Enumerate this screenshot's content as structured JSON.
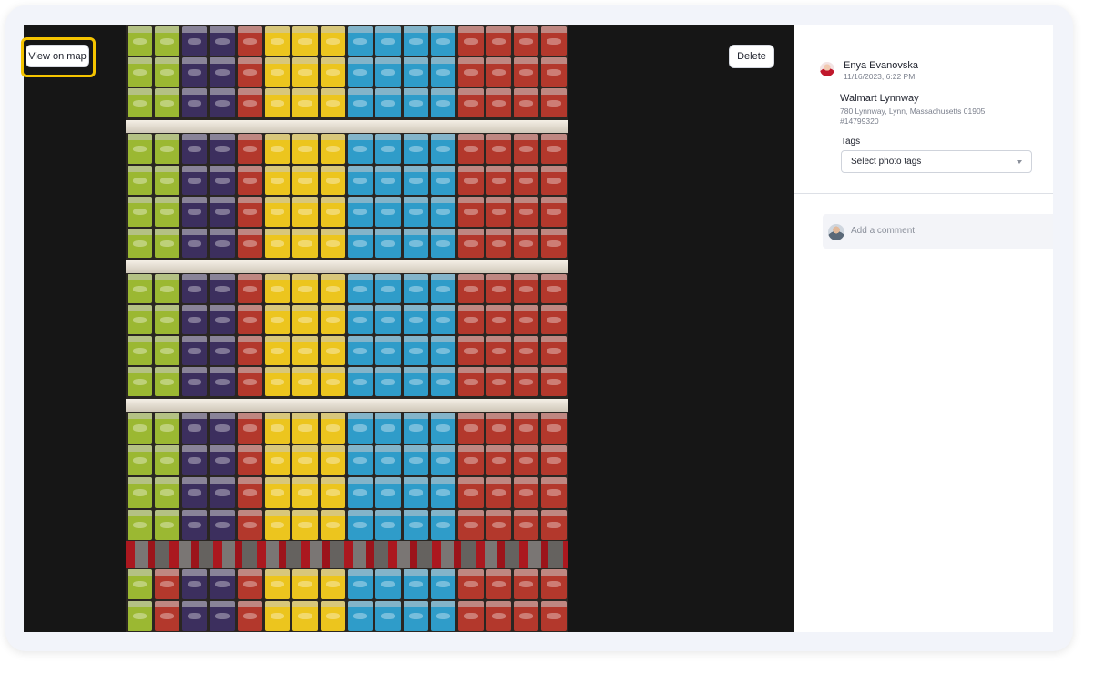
{
  "viewer": {
    "view_on_map_label": "View on map",
    "delete_label": "Delete"
  },
  "photo": {
    "subject": "store shelves stacked with colorful tins",
    "colors": {
      "green": "#9bb832",
      "purple": "#3c2f5e",
      "yellow": "#ecc51e",
      "blue": "#2f9cc9",
      "red": "#b3382c"
    }
  },
  "post": {
    "author": "Enya Evanovska",
    "datetime": "11/16/2023, 6:22 PM",
    "store_name": "Walmart Lynnway",
    "store_address": "780 Lynnway, Lynn, Massachusetts 01905",
    "store_id": "#14799320"
  },
  "tags": {
    "label": "Tags",
    "placeholder": "Select photo tags"
  },
  "comment": {
    "placeholder": "Add a comment"
  },
  "accent": "#f5c400"
}
